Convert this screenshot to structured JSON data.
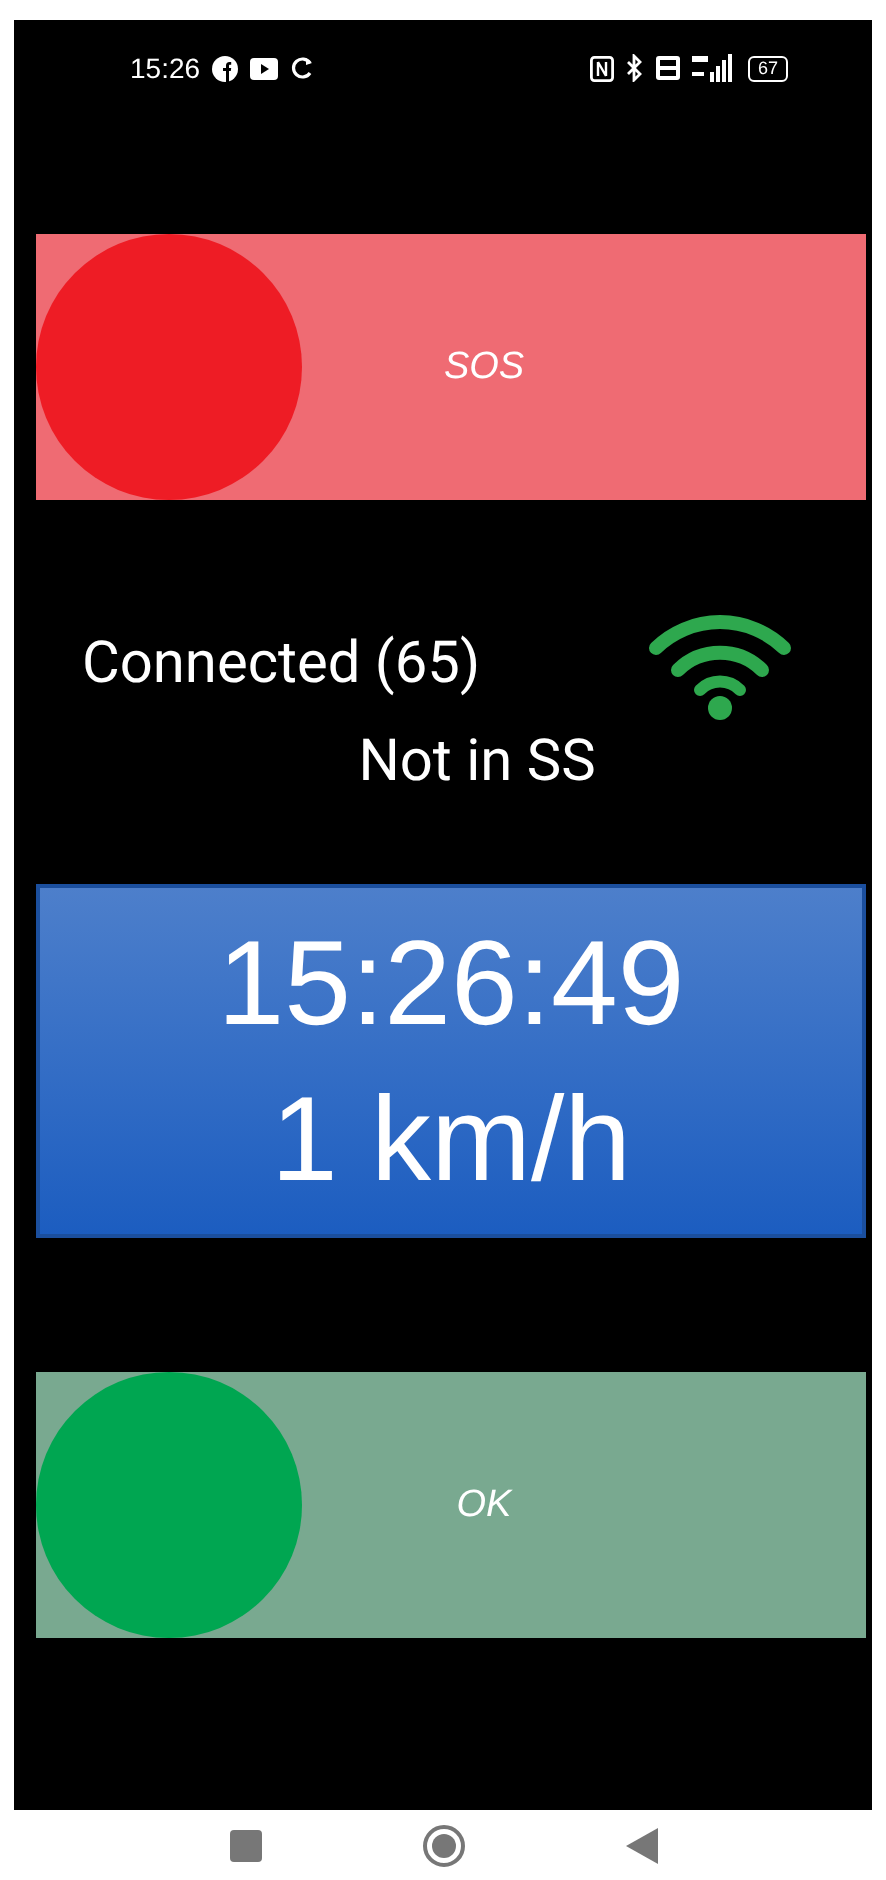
{
  "status_bar": {
    "time": "15:26",
    "battery": "67"
  },
  "buttons": [
    {
      "kind": "sos",
      "label": "SOS"
    },
    {
      "kind": "ok",
      "label": "OK"
    }
  ],
  "connection": {
    "status": "Connected (65)",
    "mode": "Not in SS"
  },
  "display": {
    "time": "15:26:49",
    "speed": "1 km/h"
  }
}
